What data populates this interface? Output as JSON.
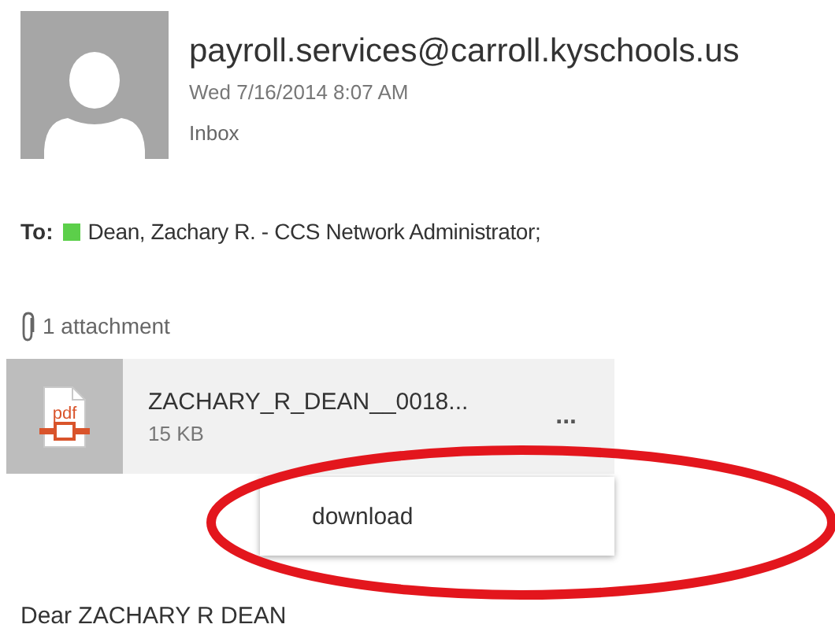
{
  "message": {
    "sender": "payroll.services@carroll.kyschools.us",
    "date": "Wed 7/16/2014 8:07 AM",
    "folder": "Inbox"
  },
  "recipients": {
    "label": "To:",
    "items": [
      {
        "name": "Dean, Zachary R. - CCS Network Administrator;",
        "color": "#5ccf4a"
      }
    ]
  },
  "attachments": {
    "count_label": "1 attachment",
    "items": [
      {
        "icon_label": "pdf",
        "file_name": "ZACHARY_R_DEAN__0018...",
        "size": "15 KB",
        "more": "..."
      }
    ]
  },
  "context_menu": {
    "items": [
      {
        "label": "download"
      }
    ]
  },
  "body": {
    "greeting": "Dear ZACHARY R DEAN"
  }
}
